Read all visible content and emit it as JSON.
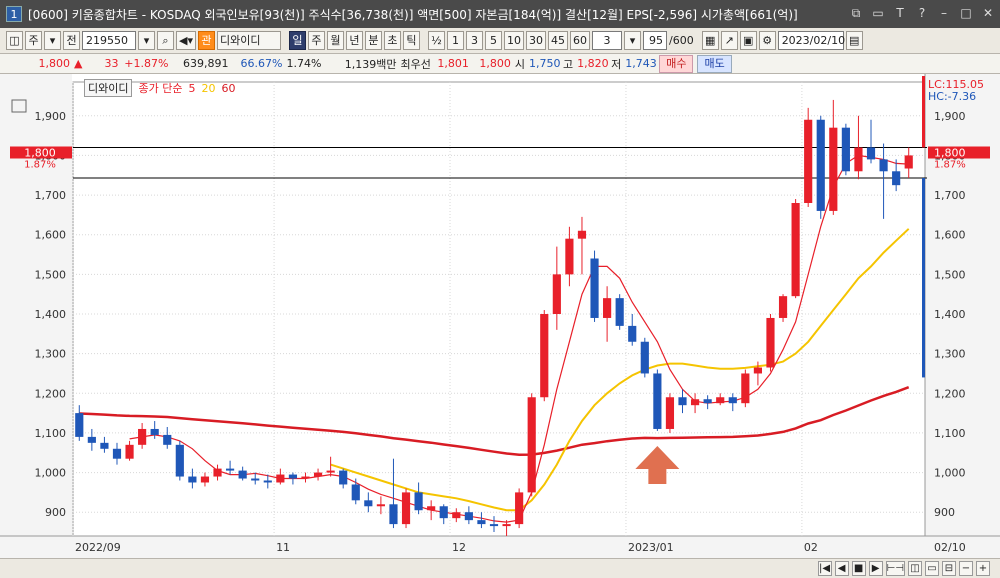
{
  "window": {
    "number": "1",
    "title": "[0600] 키움종합차트 - KOSDAQ 외국인보유[93(천)] 주식수[36,738(천)] 액면[500] 자본금[184(억)] 결산[12월] EPS[-2,596] 시가총액[661(억)]"
  },
  "toolbar": {
    "period": "주",
    "type": "전",
    "code": "219550",
    "stock_name": "디와이디",
    "tabs": [
      "일",
      "주",
      "월",
      "년",
      "분",
      "초",
      "틱"
    ],
    "fraction": "½",
    "intervals": [
      "1",
      "3",
      "5",
      "10",
      "30",
      "45",
      "60"
    ],
    "interval_select": "3",
    "count": "95",
    "count_total": "/600",
    "date": "2023/02/10"
  },
  "quote": {
    "price": "1,800",
    "change": "33",
    "change_pct": "+1.87%",
    "volume": "639,891",
    "vol_ratio": "66.67%",
    "rate": "1.74%",
    "amount": "1,139백만",
    "best_label": "최우선",
    "ask": "1,801",
    "bid": "1,800",
    "open_label": "시",
    "open": "1,750",
    "high_label": "고",
    "high": "1,820",
    "low_label": "저",
    "low": "1,743",
    "buy_label": "매수",
    "sell_label": "매도"
  },
  "legend": {
    "name": "디와이디",
    "ma_label": "종가 단순",
    "ma1": "5",
    "ma2": "20",
    "ma3": "60"
  },
  "chart_labels": {
    "lc": "LC:115.05",
    "hc": "HC:-7.36",
    "price_tag": "1,800",
    "pct_tag": "1.87%",
    "last_date": "02/10"
  },
  "colors": {
    "up": "#e8202a",
    "down": "#1f57b8",
    "ma5": "#e8202a",
    "ma20": "#f5c400",
    "ma60": "#d81c24",
    "arrow": "#e07050"
  },
  "chart_data": {
    "type": "candlestick",
    "ylim": [
      840,
      1960
    ],
    "yticks": [
      900,
      1000,
      1100,
      1200,
      1300,
      1400,
      1500,
      1600,
      1700,
      1800,
      1900
    ],
    "xticks": [
      {
        "label": "2022/09",
        "index": 0
      },
      {
        "label": "11",
        "index": 16
      },
      {
        "label": "12",
        "index": 30
      },
      {
        "label": "2023/01",
        "index": 44
      },
      {
        "label": "02",
        "index": 58
      }
    ],
    "hlines": [
      1820,
      1743
    ],
    "candles": [
      [
        1150,
        1170,
        1080,
        1090
      ],
      [
        1090,
        1110,
        1055,
        1075
      ],
      [
        1075,
        1090,
        1050,
        1060
      ],
      [
        1060,
        1075,
        1020,
        1035
      ],
      [
        1035,
        1080,
        1030,
        1070
      ],
      [
        1070,
        1125,
        1060,
        1110
      ],
      [
        1110,
        1130,
        1085,
        1095
      ],
      [
        1095,
        1115,
        1060,
        1070
      ],
      [
        1070,
        1080,
        980,
        990
      ],
      [
        990,
        1010,
        960,
        975
      ],
      [
        975,
        1000,
        965,
        990
      ],
      [
        990,
        1020,
        980,
        1010
      ],
      [
        1010,
        1030,
        995,
        1005
      ],
      [
        1005,
        1015,
        980,
        985
      ],
      [
        985,
        1000,
        970,
        980
      ],
      [
        980,
        995,
        960,
        975
      ],
      [
        975,
        1010,
        970,
        995
      ],
      [
        995,
        1000,
        970,
        985
      ],
      [
        985,
        1000,
        975,
        990
      ],
      [
        990,
        1010,
        980,
        1000
      ],
      [
        1000,
        1040,
        990,
        1005
      ],
      [
        1005,
        1010,
        960,
        970
      ],
      [
        970,
        985,
        920,
        930
      ],
      [
        930,
        950,
        900,
        915
      ],
      [
        915,
        940,
        895,
        920
      ],
      [
        920,
        1035,
        860,
        870
      ],
      [
        870,
        960,
        860,
        950
      ],
      [
        950,
        975,
        895,
        905
      ],
      [
        905,
        930,
        880,
        915
      ],
      [
        915,
        920,
        870,
        885
      ],
      [
        885,
        910,
        875,
        900
      ],
      [
        900,
        915,
        870,
        880
      ],
      [
        880,
        900,
        860,
        870
      ],
      [
        870,
        890,
        850,
        865
      ],
      [
        865,
        880,
        840,
        870
      ],
      [
        870,
        960,
        860,
        950
      ],
      [
        950,
        1200,
        940,
        1190
      ],
      [
        1190,
        1410,
        1180,
        1400
      ],
      [
        1400,
        1570,
        1360,
        1500
      ],
      [
        1500,
        1620,
        1470,
        1590
      ],
      [
        1590,
        1645,
        1500,
        1610
      ],
      [
        1540,
        1560,
        1380,
        1390
      ],
      [
        1390,
        1470,
        1330,
        1440
      ],
      [
        1440,
        1450,
        1360,
        1370
      ],
      [
        1370,
        1400,
        1320,
        1330
      ],
      [
        1330,
        1340,
        1240,
        1250
      ],
      [
        1250,
        1260,
        1105,
        1110
      ],
      [
        1110,
        1200,
        1100,
        1190
      ],
      [
        1190,
        1210,
        1150,
        1170
      ],
      [
        1170,
        1200,
        1150,
        1185
      ],
      [
        1185,
        1195,
        1160,
        1175
      ],
      [
        1175,
        1200,
        1170,
        1190
      ],
      [
        1190,
        1200,
        1155,
        1175
      ],
      [
        1175,
        1260,
        1165,
        1250
      ],
      [
        1250,
        1280,
        1220,
        1265
      ],
      [
        1265,
        1400,
        1255,
        1390
      ],
      [
        1390,
        1450,
        1380,
        1445
      ],
      [
        1445,
        1690,
        1440,
        1680
      ],
      [
        1680,
        1920,
        1670,
        1890
      ],
      [
        1890,
        1900,
        1640,
        1660
      ],
      [
        1660,
        1940,
        1650,
        1870
      ],
      [
        1870,
        1880,
        1750,
        1760
      ],
      [
        1760,
        1900,
        1740,
        1820
      ],
      [
        1820,
        1890,
        1780,
        1790
      ],
      [
        1790,
        1830,
        1640,
        1760
      ],
      [
        1760,
        1790,
        1710,
        1725
      ],
      [
        1767,
        1820,
        1743,
        1800
      ]
    ],
    "ma5": [
      null,
      null,
      null,
      null,
      1085,
      1090,
      1095,
      1090,
      1080,
      1060,
      1030,
      1005,
      995,
      995,
      998,
      992,
      985,
      985,
      985,
      990,
      995,
      990,
      975,
      958,
      945,
      935,
      925,
      915,
      905,
      900,
      895,
      890,
      885,
      878,
      875,
      880,
      950,
      1070,
      1210,
      1330,
      1450,
      1520,
      1520,
      1490,
      1430,
      1380,
      1330,
      1260,
      1210,
      1180,
      1175,
      1178,
      1180,
      1190,
      1210,
      1250,
      1310,
      1380,
      1500,
      1620,
      1720,
      1780,
      1800,
      1795,
      1790,
      1780,
      1778
    ],
    "ma20": [
      null,
      null,
      null,
      null,
      null,
      null,
      null,
      null,
      null,
      null,
      null,
      null,
      null,
      null,
      null,
      null,
      null,
      null,
      null,
      null,
      1020,
      1010,
      1000,
      990,
      980,
      970,
      960,
      950,
      945,
      940,
      935,
      928,
      920,
      912,
      905,
      905,
      930,
      970,
      1020,
      1080,
      1130,
      1170,
      1200,
      1225,
      1245,
      1260,
      1270,
      1275,
      1275,
      1270,
      1265,
      1262,
      1262,
      1264,
      1268,
      1272,
      1280,
      1300,
      1330,
      1370,
      1410,
      1450,
      1490,
      1520,
      1555,
      1585,
      1615
    ],
    "ma60": [
      null,
      null,
      null,
      null,
      null,
      null,
      null,
      null,
      null,
      null,
      null,
      null,
      null,
      null,
      null,
      null,
      null,
      null,
      null,
      null,
      null,
      null,
      null,
      null,
      null,
      null,
      null,
      null,
      null,
      null,
      null,
      null,
      null,
      null,
      null,
      null,
      null,
      null,
      null,
      null,
      null,
      null,
      null,
      null,
      null,
      null,
      null,
      null,
      null,
      null,
      null,
      null,
      null,
      null,
      null,
      null,
      null,
      null,
      null,
      null,
      null,
      null,
      null,
      null,
      null,
      null,
      null
    ]
  }
}
